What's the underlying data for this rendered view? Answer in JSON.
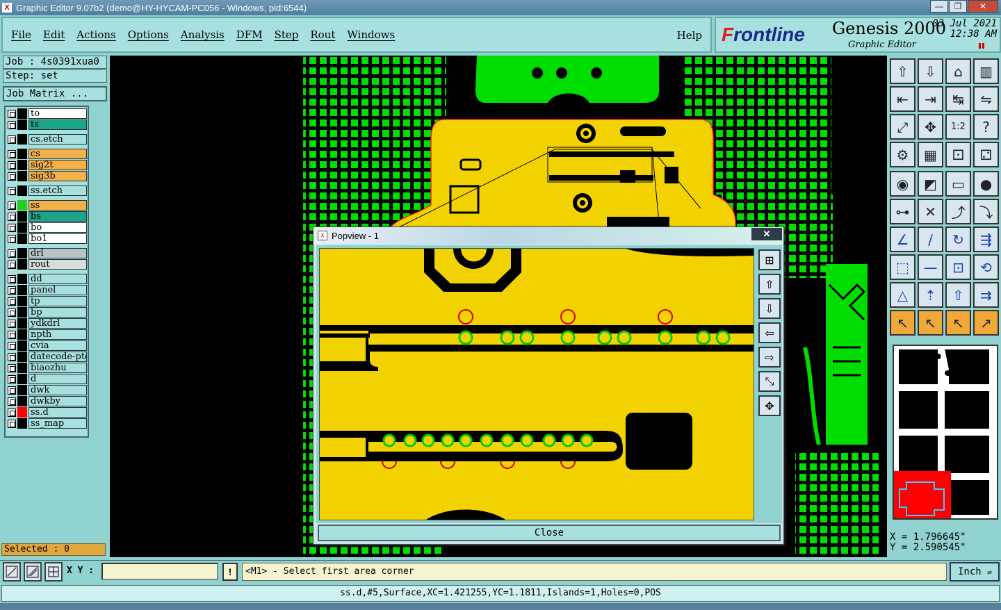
{
  "window": {
    "title": "Graphic Editor 9.07b2 (demo@HY-HYCAM-PC056 - Windows, pid:6544)",
    "minimize": "—",
    "maximize": "❐",
    "close": "✕"
  },
  "menu": {
    "items": [
      "File",
      "Edit",
      "Actions",
      "Options",
      "Analysis",
      "DFM",
      "Step",
      "Rout",
      "Windows"
    ],
    "help": "Help"
  },
  "branding": {
    "logo": "Frontline",
    "product": "Genesis 2000",
    "subtitle": "Graphic Editor",
    "date": "03 Jul 2021",
    "time": "12:38 AM"
  },
  "job": {
    "job_label": "Job : 4s0391xua0",
    "step_label": "Step: set",
    "matrix_button": "Job Matrix ..."
  },
  "layers": [
    {
      "name": "to",
      "color": "#ffffff",
      "swatch": "#000000"
    },
    {
      "name": "ts",
      "color": "#1aa58a",
      "swatch": "#000000"
    },
    {
      "name": "cs.etch",
      "color": "#a7e0de",
      "swatch": "#000000"
    },
    {
      "name": "cs",
      "color": "#f3b14a",
      "swatch": "#000000"
    },
    {
      "name": "sig2t",
      "color": "#f3b14a",
      "swatch": "#000000"
    },
    {
      "name": "sig3b",
      "color": "#f3b14a",
      "swatch": "#000000"
    },
    {
      "name": "ss.etch",
      "color": "#a7e0de",
      "swatch": "#000000"
    },
    {
      "name": "ss",
      "color": "#f3b14a",
      "swatch": "#22cc22"
    },
    {
      "name": "bs",
      "color": "#1aa58a",
      "swatch": "#000000"
    },
    {
      "name": "bo",
      "color": "#ffffff",
      "swatch": "#000000"
    },
    {
      "name": "bo1",
      "color": "#ffffff",
      "swatch": "#000000"
    },
    {
      "name": "drl",
      "color": "#b8c4c8",
      "swatch": "#000000"
    },
    {
      "name": "rout",
      "color": "#d8dcdc",
      "swatch": "#000000"
    },
    {
      "name": "dd",
      "color": "#a7e0de",
      "swatch": "#000000"
    },
    {
      "name": "panel",
      "color": "#a7e0de",
      "swatch": "#000000"
    },
    {
      "name": "tp",
      "color": "#a7e0de",
      "swatch": "#000000"
    },
    {
      "name": "bp",
      "color": "#a7e0de",
      "swatch": "#000000"
    },
    {
      "name": "ydkdrl",
      "color": "#a7e0de",
      "swatch": "#000000"
    },
    {
      "name": "npth",
      "color": "#a7e0de",
      "swatch": "#000000"
    },
    {
      "name": "cvia",
      "color": "#a7e0de",
      "swatch": "#000000"
    },
    {
      "name": "datecode-ptc",
      "color": "#a7e0de",
      "swatch": "#000000"
    },
    {
      "name": "biaozhu",
      "color": "#a7e0de",
      "swatch": "#000000"
    },
    {
      "name": "d",
      "color": "#a7e0de",
      "swatch": "#000000"
    },
    {
      "name": "dwk",
      "color": "#a7e0de",
      "swatch": "#000000"
    },
    {
      "name": "dwkby",
      "color": "#a7e0de",
      "swatch": "#000000"
    },
    {
      "name": "ss.d",
      "color": "#a7e0de",
      "swatch": "#ff0000"
    },
    {
      "name": "ss_map",
      "color": "#a7e0de",
      "swatch": "#000000"
    }
  ],
  "selected": "Selected : 0",
  "popview": {
    "title": "Popview - 1",
    "close_label": "Close",
    "close_x": "✕"
  },
  "coords": {
    "x": "X = 1.796645\"",
    "y": "Y = 2.590545\""
  },
  "command": {
    "xy_label": "X Y :",
    "xy_value": "",
    "alert": "!",
    "prompt": "<M1> - Select first area corner",
    "units": "Inch"
  },
  "status": "ss.d,#5,Surface,XC=1.421255,YC=1.1811,Islands=1,Holes=0,POS",
  "colors": {
    "copper": "#f2d200",
    "pads": "#00dd00",
    "background": "#000000",
    "panel": "#8fd2d0",
    "highlight": "#ff0000"
  }
}
